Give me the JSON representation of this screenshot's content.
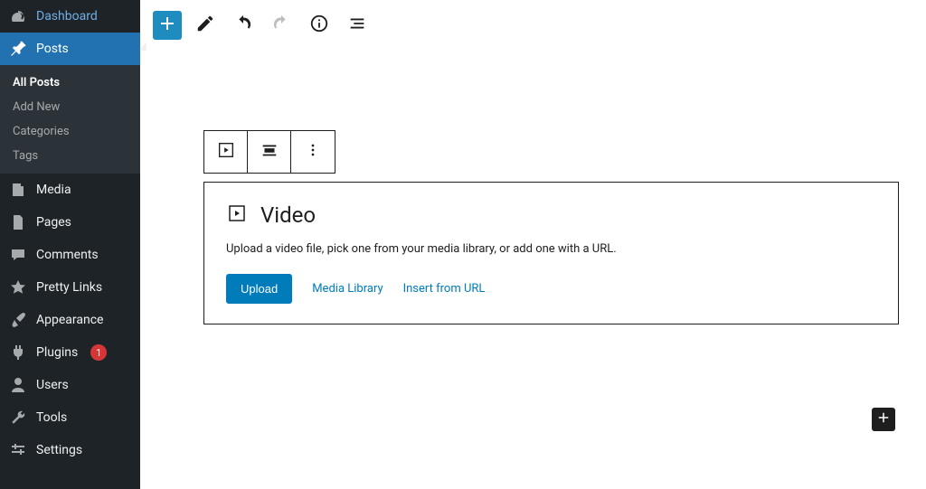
{
  "sidebar": {
    "items": [
      {
        "label": "Dashboard"
      },
      {
        "label": "Posts"
      },
      {
        "label": "Media"
      },
      {
        "label": "Pages"
      },
      {
        "label": "Comments"
      },
      {
        "label": "Pretty Links"
      },
      {
        "label": "Appearance"
      },
      {
        "label": "Plugins",
        "badge": "1"
      },
      {
        "label": "Users"
      },
      {
        "label": "Tools"
      },
      {
        "label": "Settings"
      }
    ],
    "submenu": [
      {
        "label": "All Posts"
      },
      {
        "label": "Add New"
      },
      {
        "label": "Categories"
      },
      {
        "label": "Tags"
      }
    ]
  },
  "block": {
    "title": "Video",
    "description": "Upload a video file, pick one from your media library, or add one with a URL.",
    "upload_label": "Upload",
    "library_label": "Media Library",
    "url_label": "Insert from URL"
  }
}
